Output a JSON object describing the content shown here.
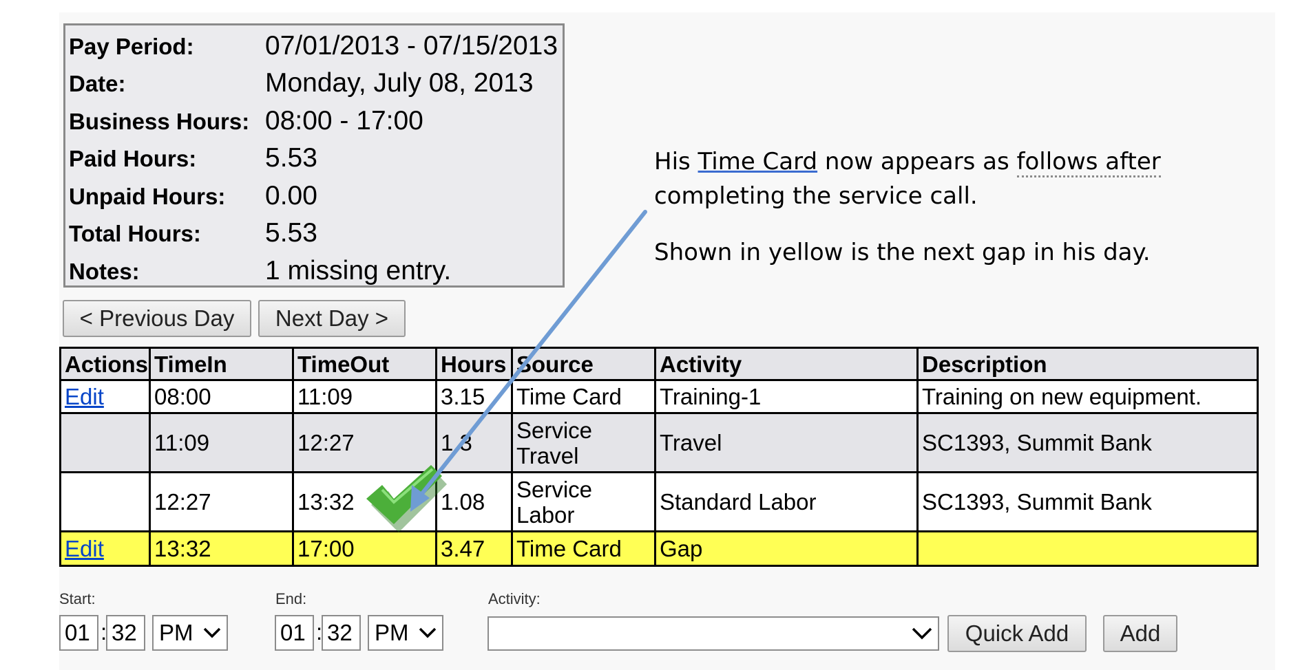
{
  "summary": {
    "rows": [
      {
        "label": "Pay Period:",
        "value": "07/01/2013 - 07/15/2013"
      },
      {
        "label": "Date:",
        "value": "Monday, July 08, 2013"
      },
      {
        "label": "Business Hours:",
        "value": "08:00 - 17:00"
      },
      {
        "label": "Paid Hours:",
        "value": "5.53"
      },
      {
        "label": "Unpaid Hours:",
        "value": "0.00"
      },
      {
        "label": "Total Hours:",
        "value": "5.53"
      },
      {
        "label": "Notes:",
        "value": "1 missing entry."
      }
    ]
  },
  "nav": {
    "previous_label": "< Previous Day",
    "next_label": "Next Day >"
  },
  "table": {
    "headers": [
      "Actions",
      "TimeIn",
      "TimeOut",
      "Hours",
      "Source",
      "Activity",
      "Description"
    ],
    "rows": [
      {
        "action": "Edit",
        "time_in": "08:00",
        "time_out": "11:09",
        "hours": "3.15",
        "source_1": "Time Card",
        "source_2": "",
        "activity": "Training-1",
        "description": "Training on new equipment."
      },
      {
        "action": "",
        "time_in": "11:09",
        "time_out": "12:27",
        "hours": "1.3",
        "source_1": "Service",
        "source_2": "Travel",
        "activity": "Travel",
        "description": "SC1393, Summit Bank"
      },
      {
        "action": "",
        "time_in": "12:27",
        "time_out": "13:32",
        "hours": "1.08",
        "source_1": "Service",
        "source_2": "Labor",
        "activity": "Standard Labor",
        "description": "SC1393, Summit Bank"
      },
      {
        "action": "Edit",
        "time_in": "13:32",
        "time_out": "17:00",
        "hours": "3.47",
        "source_1": "Time Card",
        "source_2": "",
        "activity": "Gap",
        "description": ""
      }
    ]
  },
  "form": {
    "start_label": "Start:",
    "start_hour": "01",
    "start_minute": "32",
    "start_ampm": "PM",
    "end_label": "End:",
    "end_hour": "01",
    "end_minute": "32",
    "end_ampm": "PM",
    "colon": ":",
    "activity_label": "Activity:",
    "activity_value": "",
    "quick_add_label": "Quick Add",
    "add_label": "Add"
  },
  "annotation": {
    "line1_pre": "His ",
    "line1_link": "Time Card",
    "line1_mid": " now appears as ",
    "line1_dotted": "follows after",
    "line2": "completing the service call.",
    "line3": "Shown in yellow is the next gap in his day."
  },
  "colors": {
    "arrow": "#6f9cd4",
    "check": "#4caf3a",
    "gap_row": "#ffff55",
    "link": "#0645c8"
  },
  "icons": {
    "checkmark": "check-icon",
    "arrow": "arrow-annotation",
    "dropdown": "chevron-down-icon"
  }
}
